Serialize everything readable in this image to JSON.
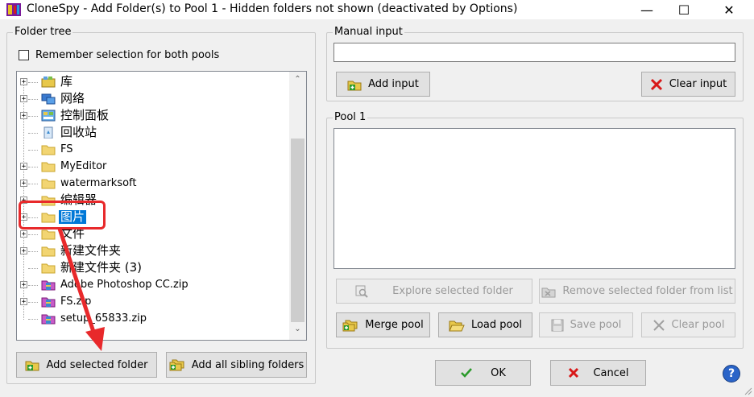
{
  "window": {
    "title": "CloneSpy - Add Folder(s) to Pool 1 - Hidden folders not shown (deactivated by Options)",
    "minimize_glyph": "—",
    "maximize_glyph": "☐",
    "close_glyph": "✕"
  },
  "folder_tree": {
    "legend": "Folder tree",
    "remember_label": "Remember selection for both pools",
    "remember_checked": false,
    "items": [
      {
        "label": "库",
        "icon": "library-icon",
        "expandable": true
      },
      {
        "label": "网络",
        "icon": "network-icon",
        "expandable": true
      },
      {
        "label": "控制面板",
        "icon": "control-panel-icon",
        "expandable": true
      },
      {
        "label": "回收站",
        "icon": "recycle-bin-icon",
        "expandable": false
      },
      {
        "label": "FS",
        "icon": "folder-icon",
        "expandable": false
      },
      {
        "label": "MyEditor",
        "icon": "folder-icon",
        "expandable": true
      },
      {
        "label": "watermarksoft",
        "icon": "folder-icon",
        "expandable": true
      },
      {
        "label": "编辑器",
        "icon": "folder-icon",
        "expandable": true
      },
      {
        "label": "图片",
        "icon": "folder-icon",
        "expandable": true,
        "selected": true
      },
      {
        "label": "文件",
        "icon": "folder-icon",
        "expandable": true
      },
      {
        "label": "新建文件夹",
        "icon": "folder-icon",
        "expandable": true
      },
      {
        "label": "新建文件夹 (3)",
        "icon": "folder-icon",
        "expandable": false
      },
      {
        "label": "Adobe Photoshop CC.zip",
        "icon": "archive-icon",
        "expandable": true
      },
      {
        "label": "FS.zip",
        "icon": "archive-icon",
        "expandable": true
      },
      {
        "label": "setup_65833.zip",
        "icon": "archive-icon",
        "expandable": false
      }
    ],
    "add_selected_label": "Add selected folder",
    "add_all_siblings_label": "Add all sibling folders"
  },
  "manual_input": {
    "legend": "Manual input",
    "value": "",
    "add_label": "Add input",
    "clear_label": "Clear input"
  },
  "pool": {
    "legend": "Pool 1",
    "explore_label": "Explore selected folder",
    "remove_label": "Remove selected folder from list",
    "merge_label": "Merge pool",
    "load_label": "Load pool",
    "save_label": "Save pool",
    "clear_label": "Clear pool"
  },
  "dialog": {
    "ok_label": "OK",
    "cancel_label": "Cancel",
    "help_glyph": "?"
  },
  "colors": {
    "selection": "#0078d7",
    "annotation_red": "#e8292b"
  }
}
